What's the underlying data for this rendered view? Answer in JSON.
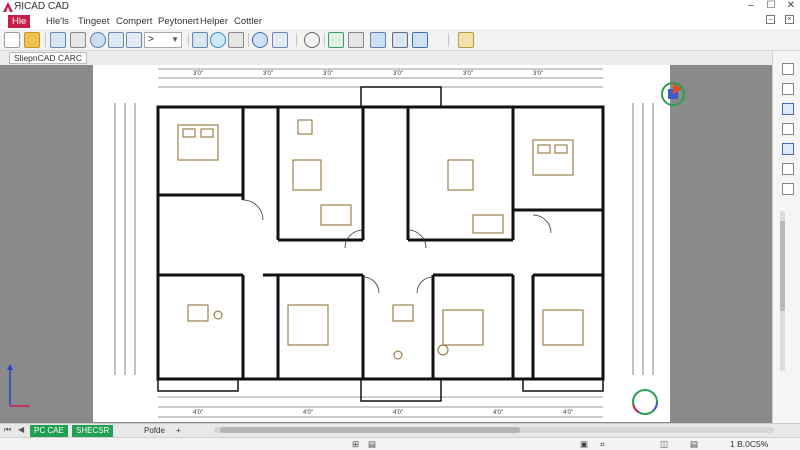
{
  "app": {
    "title": "ЯICAD CAD"
  },
  "menu": {
    "items": [
      "Hle",
      "Hle'ls",
      "Tingeet",
      "Compert",
      "Peytonert",
      "Helper",
      "Cottler"
    ]
  },
  "toolbar": {
    "dropdown_value": ">"
  },
  "document": {
    "tab_label": "SliepnCAD CARC"
  },
  "sheet_tabs": {
    "model_label": "PC CAE",
    "layout1_label": "SHECSR",
    "layout2_label": "Pofde",
    "add_label": "+"
  },
  "status": {
    "left1": "⊞",
    "left2": "▤",
    "coords": "1 B.0C5%"
  },
  "colors": {
    "menu_active_bg": "#c81e4a",
    "tab_active_bg": "#20a050",
    "canvas_bg": "#8a8a8a",
    "line_color": "#1a1a1a",
    "furniture_color": "#8a6a2a"
  },
  "icons": [
    "app-logo-icon",
    "minimize-icon",
    "maximize-icon",
    "close-icon",
    "new-file-icon",
    "open-folder-icon",
    "save-icon",
    "print-icon",
    "zoom-icon",
    "pan-icon",
    "compass-icon",
    "nav-cube-icon"
  ]
}
